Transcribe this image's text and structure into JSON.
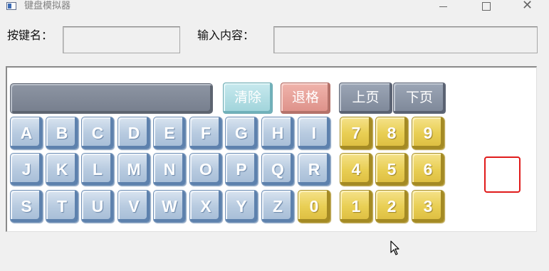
{
  "window": {
    "title": "键盘模拟器",
    "controls": {
      "minimize": "minimize",
      "maximize": "maximize",
      "close": "close"
    }
  },
  "form": {
    "key_name_label": "按键名：",
    "key_name_value": "",
    "input_content_label": "输入内容：",
    "input_content_value": ""
  },
  "function_buttons": {
    "clear": "清除",
    "backspace": "退格",
    "page_up": "上页",
    "page_down": "下页"
  },
  "letter_keys": [
    [
      "A",
      "B",
      "C",
      "D",
      "E",
      "F",
      "G",
      "H",
      "I"
    ],
    [
      "J",
      "K",
      "L",
      "M",
      "N",
      "O",
      "P",
      "Q",
      "R"
    ],
    [
      "S",
      "T",
      "U",
      "V",
      "W",
      "X",
      "Y",
      "Z",
      "0"
    ]
  ],
  "digit_keys": [
    [
      "7",
      "8",
      "9"
    ],
    [
      "4",
      "5",
      "6"
    ],
    [
      "1",
      "2",
      "3"
    ]
  ],
  "colors": {
    "letter_key": "#a5bcd6",
    "digit_key": "#e9cf55",
    "clear_button": "#9fd3da",
    "backspace_button": "#dd9088",
    "page_button": "#7d8798",
    "highlight_box": "#e01b1b"
  }
}
